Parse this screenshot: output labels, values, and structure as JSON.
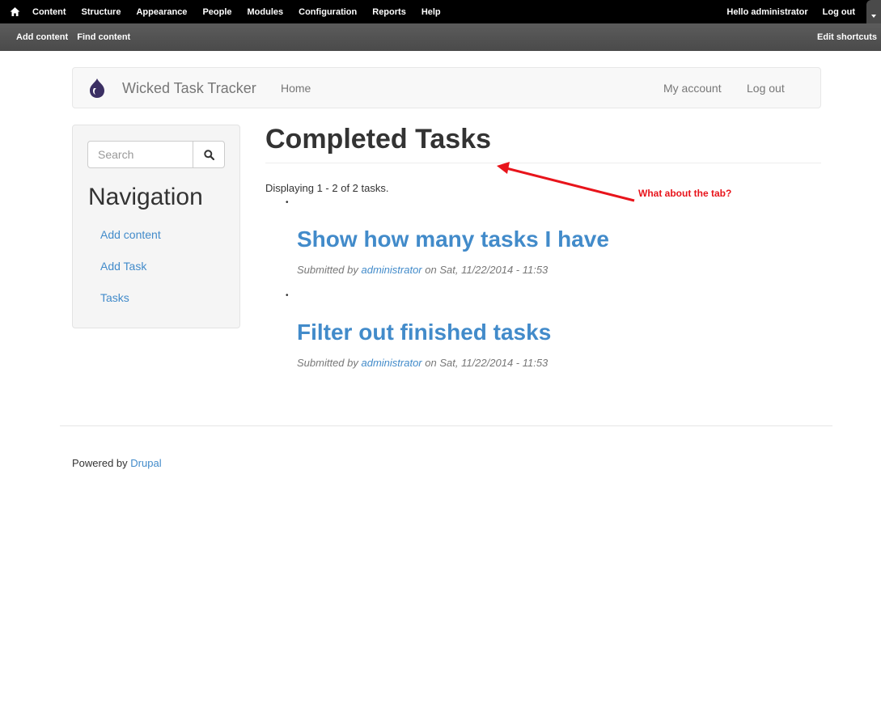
{
  "admin_toolbar": {
    "home_icon": "home-icon",
    "menu": [
      "Content",
      "Structure",
      "Appearance",
      "People",
      "Modules",
      "Configuration",
      "Reports",
      "Help"
    ],
    "greeting_prefix": "Hello",
    "user": "administrator",
    "logout": "Log out"
  },
  "shortcuts": {
    "items": [
      "Add content",
      "Find content"
    ],
    "edit": "Edit shortcuts"
  },
  "navbar": {
    "logo_icon": "drupal-drop-icon",
    "brand": "Wicked Task Tracker",
    "home": "Home",
    "my_account": "My account",
    "logout": "Log out"
  },
  "sidebar": {
    "search": {
      "placeholder": "Search",
      "value": "",
      "button_icon": "search-icon"
    },
    "title": "Navigation",
    "links": [
      "Add content",
      "Add Task",
      "Tasks"
    ]
  },
  "main": {
    "title": "Completed Tasks",
    "summary": "Displaying 1 - 2 of 2 tasks.",
    "tasks": [
      {
        "title": "Show how many tasks I have",
        "submitted_by": "Submitted by",
        "author": "administrator",
        "date": "on Sat, 11/22/2014 - 11:53"
      },
      {
        "title": "Filter out finished tasks",
        "submitted_by": "Submitted by",
        "author": "administrator",
        "date": "on Sat, 11/22/2014 - 11:53"
      }
    ]
  },
  "annotation": {
    "text": "What about the tab?",
    "color": "#e8141b"
  },
  "footer": {
    "prefix": "Powered by",
    "link": "Drupal"
  },
  "colors": {
    "link": "#428bca",
    "toolbar": "#000000",
    "shortcut_bar": "#4f4f4f"
  }
}
